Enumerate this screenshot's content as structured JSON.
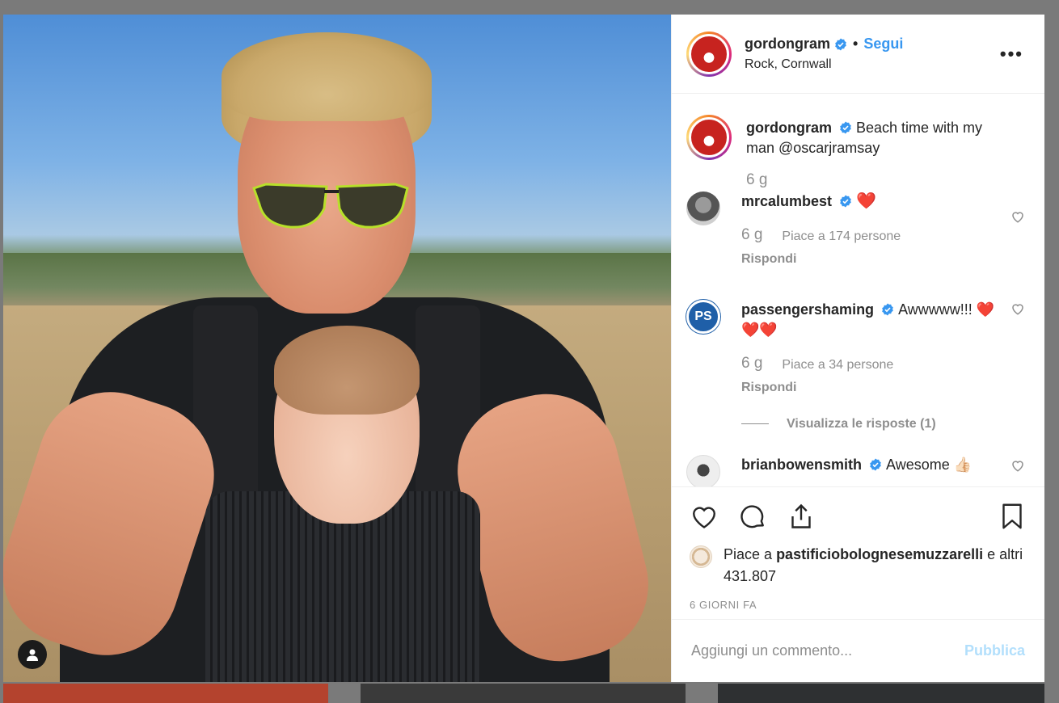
{
  "post": {
    "username": "gordongram",
    "location": "Rock, Cornwall",
    "follow_label": "Segui",
    "separator": "•",
    "more_label": "•••"
  },
  "caption": {
    "username": "gordongram",
    "text": "Beach time with my man @oscarjramsay",
    "age": "6 g"
  },
  "comments": [
    {
      "username": "mrcalumbest",
      "text": "❤️",
      "age": "6 g",
      "likes": "Piace a 174 persone",
      "reply_label": "Rispondi"
    },
    {
      "username": "passengershaming",
      "text": "Awwwww!!! ❤️❤️❤️",
      "age": "6 g",
      "likes": "Piace a 34 persone",
      "reply_label": "Rispondi",
      "view_replies": "Visualizza le risposte (1)",
      "avatar_text": "PS"
    },
    {
      "username": "brianbowensmith",
      "text": "Awesome 👍🏻"
    }
  ],
  "actions": {
    "likes_prefix": "Piace a",
    "liker": "pastificiobolognesemuzzarelli",
    "likes_suffix": "e altri 431.807",
    "time_ago": "6 GIORNI FA"
  },
  "add_comment": {
    "placeholder": "Aggiungi un commento...",
    "publish_label": "Pubblica"
  },
  "colors": {
    "link_blue": "#3897f0",
    "verified_blue": "#3897f0",
    "publish_disabled": "#b2dffc",
    "muted": "#8e8e8e"
  }
}
